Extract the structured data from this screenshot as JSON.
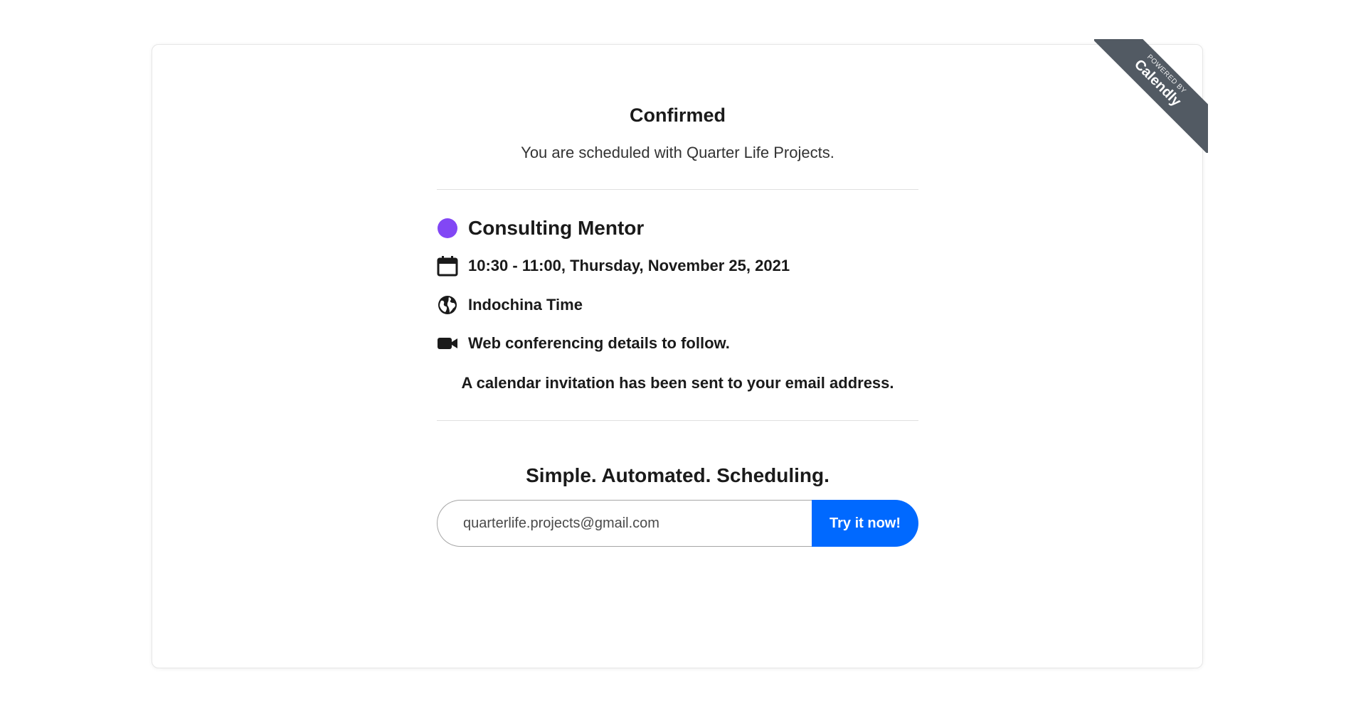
{
  "ribbon": {
    "powered_by": "POWERED BY",
    "brand": "Calendly"
  },
  "confirmation": {
    "title": "Confirmed",
    "subtitle": "You are scheduled with Quarter Life Projects."
  },
  "event": {
    "name": "Consulting Mentor",
    "color": "#8247f5",
    "datetime": "10:30 - 11:00, Thursday, November 25, 2021",
    "timezone": "Indochina Time",
    "location": "Web conferencing details to follow.",
    "notice": "A calendar invitation has been sent to your email address."
  },
  "promo": {
    "title": "Simple. Automated. Scheduling.",
    "email_value": "quarterlife.projects@gmail.com",
    "button_label": "Try it now!",
    "button_color": "#0069ff"
  },
  "icons": {
    "event_color": "color-dot-icon",
    "date": "calendar-icon",
    "timezone": "globe-icon",
    "location": "video-camera-icon"
  }
}
